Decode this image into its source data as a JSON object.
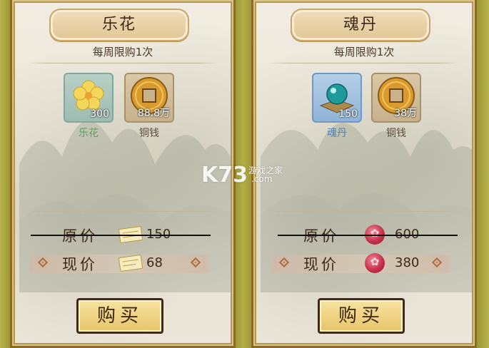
{
  "theme": {
    "accent": "#8c6a22",
    "item_label_left": "#5aa15c",
    "item_label_right": "#4a83b8",
    "coin_label": "#5b4a38"
  },
  "cards": [
    {
      "title": "乐花",
      "limit": "每周限购1次",
      "items": [
        {
          "name": "乐花",
          "qty": "300",
          "icon": "yellow-flower-icon"
        },
        {
          "name": "铜钱",
          "qty": "88.8万",
          "icon": "copper-coin-icon"
        }
      ],
      "original_price": {
        "label": "原价",
        "value": "150",
        "currency_icon": "ticket-icon"
      },
      "current_price": {
        "label": "现价",
        "value": "68",
        "currency_icon": "ticket-icon"
      },
      "buy_label": "购买"
    },
    {
      "title": "魂丹",
      "limit": "每周限购1次",
      "items": [
        {
          "name": "魂丹",
          "qty": "150",
          "icon": "soul-orb-icon"
        },
        {
          "name": "铜钱",
          "qty": "38万",
          "icon": "copper-coin-icon"
        }
      ],
      "original_price": {
        "label": "原价",
        "value": "600",
        "currency_icon": "red-gem-icon"
      },
      "current_price": {
        "label": "现价",
        "value": "380",
        "currency_icon": "red-gem-icon"
      },
      "buy_label": "购买"
    }
  ],
  "watermark": {
    "logo": "K73",
    "line1": "游戏之家",
    "line2": ".com"
  }
}
